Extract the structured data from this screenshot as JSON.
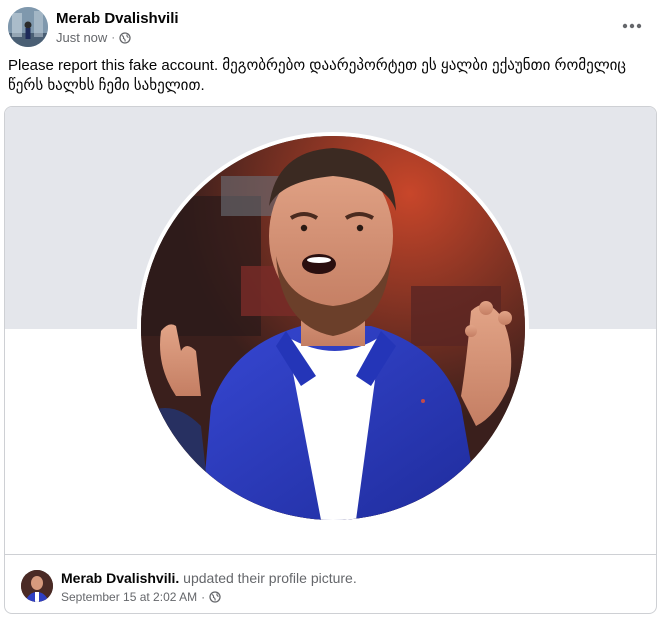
{
  "post": {
    "author": "Merab Dvalishvili",
    "timestamp": "Just now",
    "separator": "·",
    "audience_icon": "globe-icon",
    "more_icon": "more-options-icon",
    "text": "Please report this fake account. მეგობრებო დაარეპორტეთ ეს ყალბი ექაუნთი რომელიც წერს ხალხს ჩემი სახელით."
  },
  "shared_card": {
    "author": "Merab Dvalishvili.",
    "action": "updated their profile picture.",
    "timestamp": "September 15 at 2:02 AM",
    "separator": "·",
    "audience_icon": "globe-icon"
  },
  "colors": {
    "cover_background": "#e4e6eb",
    "secondary_text": "#65676b",
    "primary_text": "#050505",
    "shirt_blue": "#2d3fc4"
  }
}
